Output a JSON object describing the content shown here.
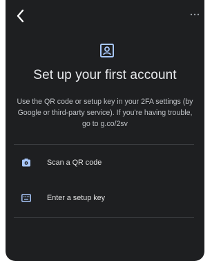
{
  "header": {
    "back_icon": "chevron-left-icon",
    "more_icon": "more-horizontal-icon"
  },
  "hero": {
    "icon": "account-box-icon",
    "title": "Set up your first account",
    "description": "Use the QR code or setup key in your 2FA settings (by Google or third-party service). If you're having trouble, go to g.co/2sv"
  },
  "options": [
    {
      "icon": "camera-icon",
      "label": "Scan a QR code"
    },
    {
      "icon": "keyboard-icon",
      "label": "Enter a setup key"
    }
  ],
  "colors": {
    "background": "#1e1f21",
    "text": "#e3e3e3",
    "accent_icon": "#a8c7fa",
    "divider": "#3d3f43"
  }
}
